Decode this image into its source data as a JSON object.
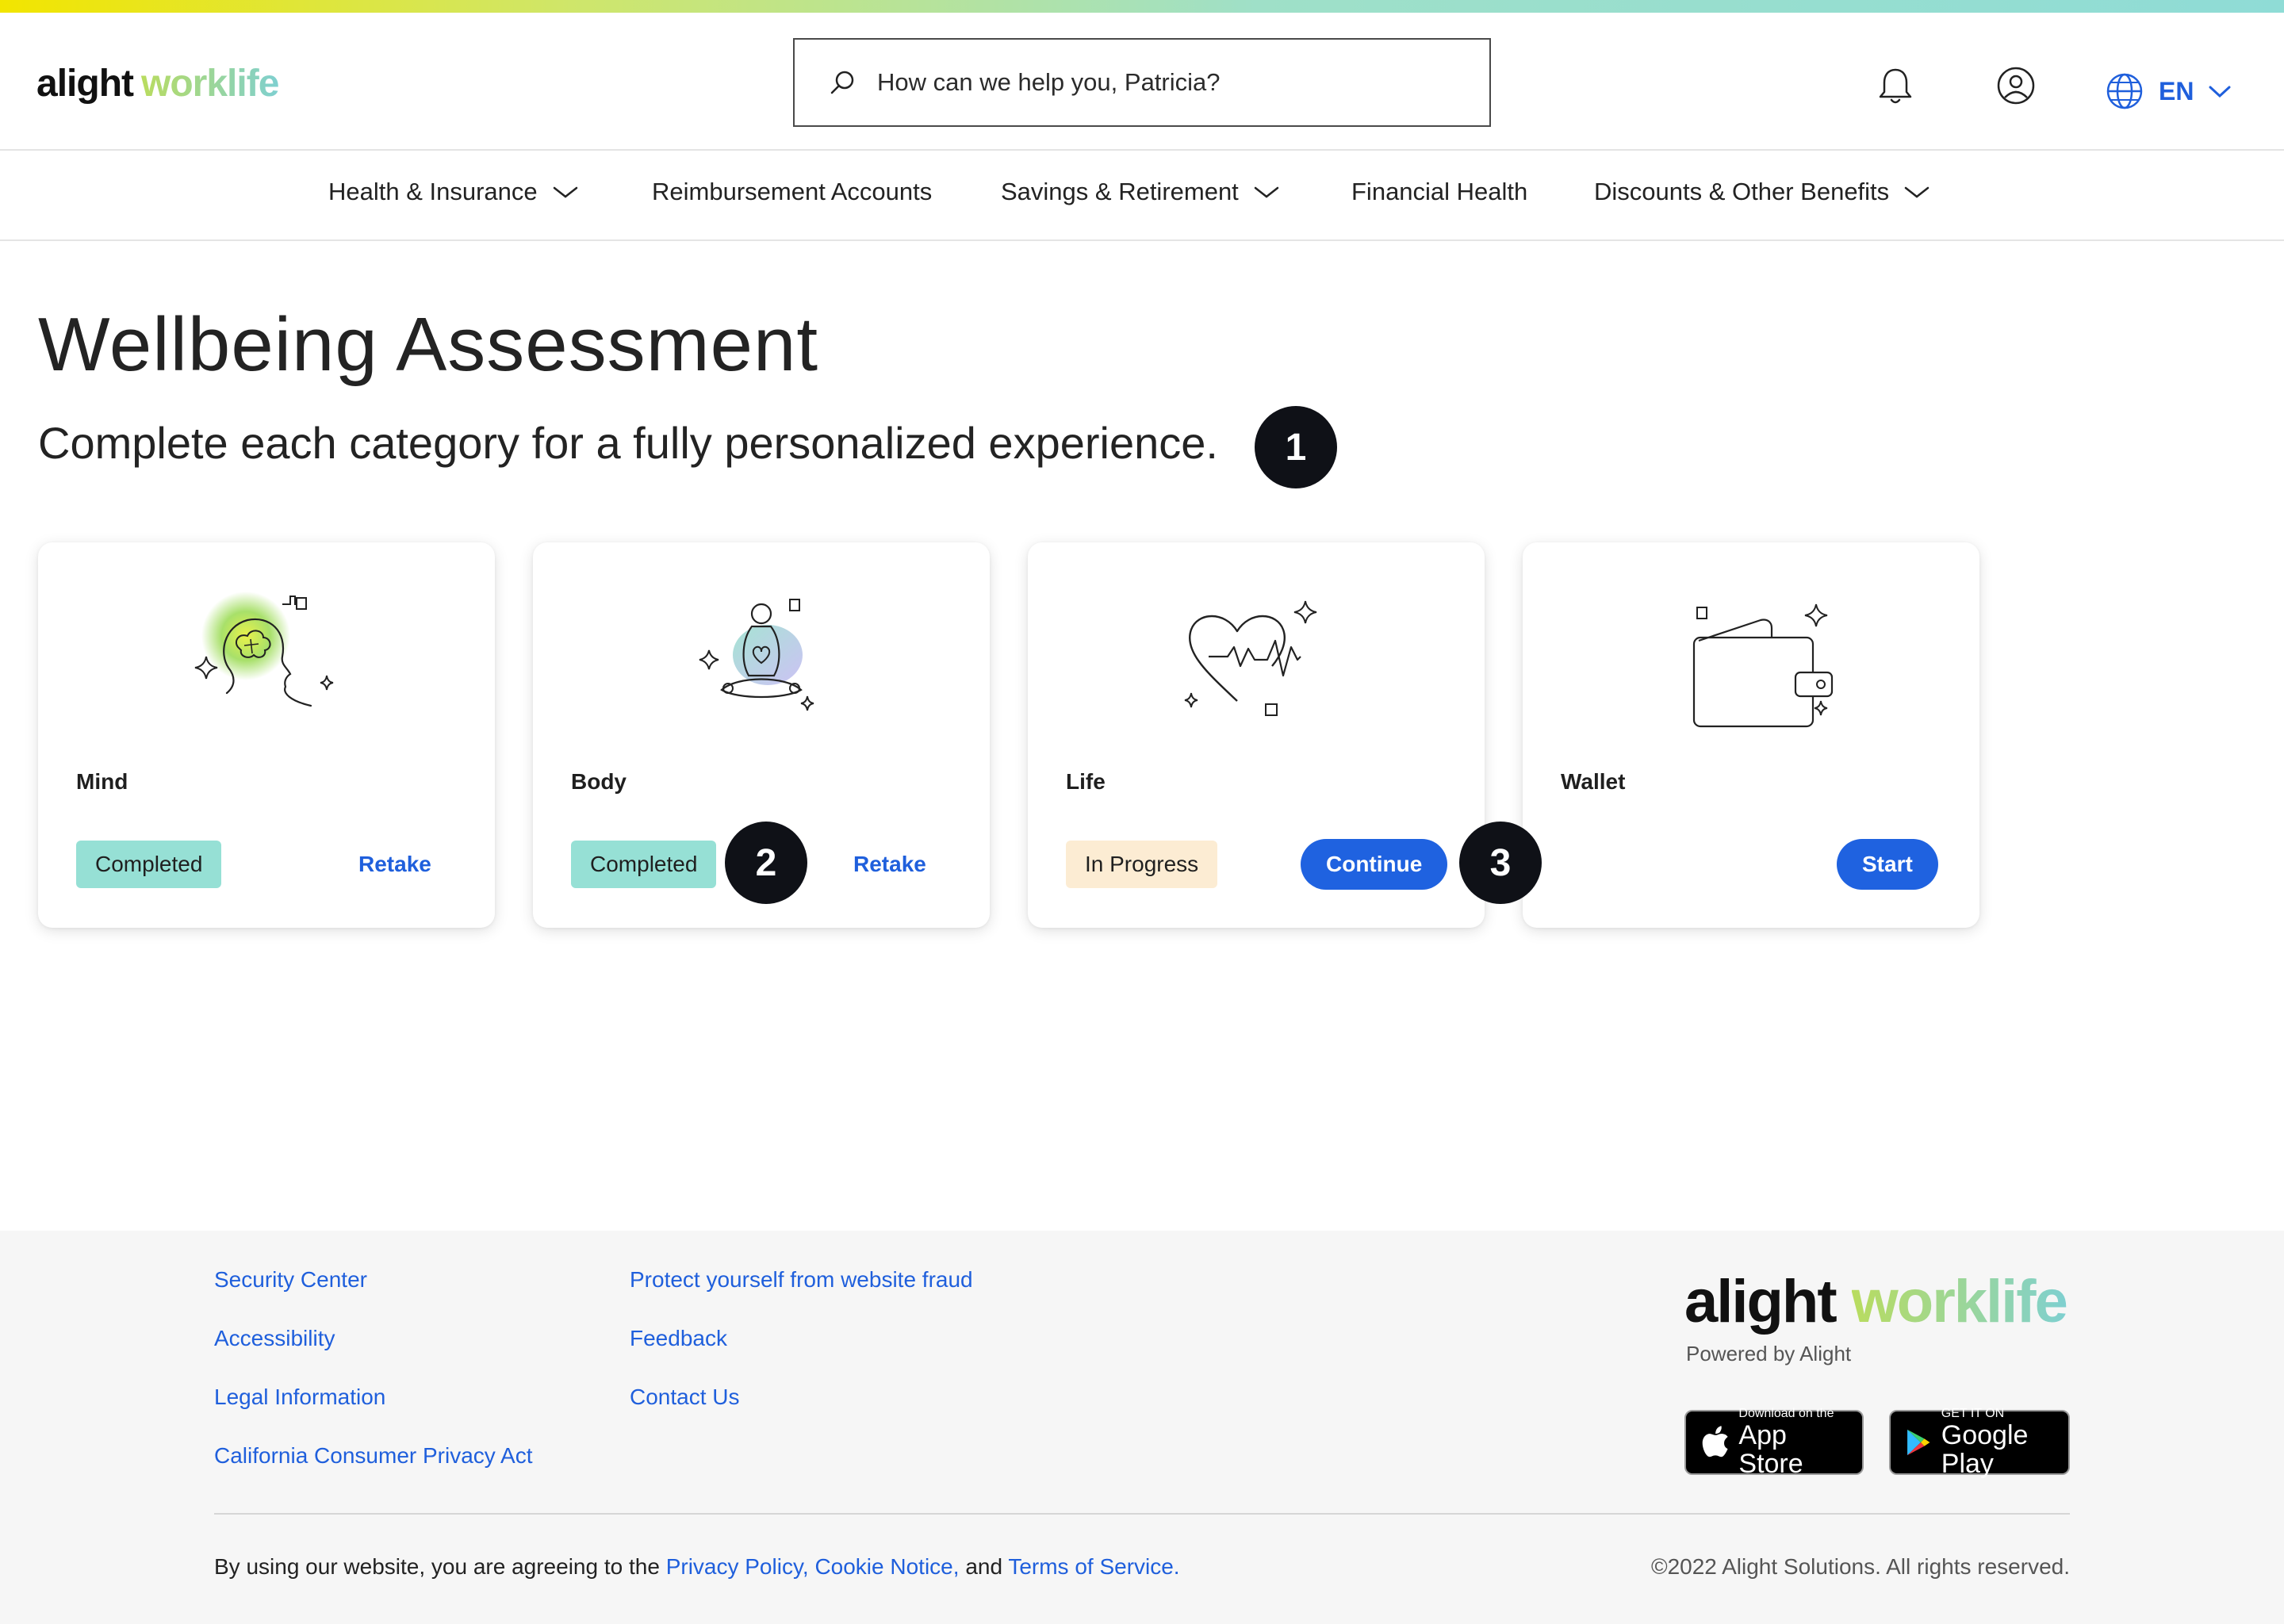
{
  "brand": {
    "logo_main": "alight",
    "logo_accent": "worklife"
  },
  "search": {
    "placeholder": "How can we help you, Patricia?"
  },
  "header": {
    "lang_code": "EN"
  },
  "nav": {
    "items": [
      {
        "label": "Health & Insurance",
        "has_dropdown": true
      },
      {
        "label": "Reimbursement Accounts",
        "has_dropdown": false
      },
      {
        "label": "Savings & Retirement",
        "has_dropdown": true
      },
      {
        "label": "Financial Health",
        "has_dropdown": false
      },
      {
        "label": "Discounts & Other Benefits",
        "has_dropdown": true
      }
    ]
  },
  "page": {
    "title": "Wellbeing Assessment",
    "subtitle": "Complete each category for a fully personalized experience."
  },
  "markers": [
    "1",
    "2",
    "3"
  ],
  "cards": [
    {
      "name": "Mind",
      "status": "Completed",
      "action": "Retake",
      "icon": "brain-head-icon"
    },
    {
      "name": "Body",
      "status": "Completed",
      "action": "Retake",
      "icon": "meditation-figure-icon"
    },
    {
      "name": "Life",
      "status": "In Progress",
      "action": "Continue",
      "icon": "heart-pulse-icon"
    },
    {
      "name": "Wallet",
      "status": "",
      "action": "Start",
      "icon": "wallet-icon"
    }
  ],
  "footer": {
    "col1": [
      "Security Center",
      "Accessibility",
      "Legal Information",
      "California Consumer Privacy Act"
    ],
    "col2": [
      "Protect yourself from website fraud",
      "Feedback",
      "Contact Us"
    ],
    "logo_main": "alight",
    "logo_accent": "worklife",
    "powered": "Powered by Alight",
    "appstore": {
      "small": "Download on the",
      "large": "App Store"
    },
    "googleplay": {
      "small": "GET IT ON",
      "large": "Google Play"
    },
    "legal_prefix": "By using our website, you are agreeing to the",
    "privacy": "Privacy Policy,",
    "cookie": "Cookie Notice,",
    "and": "and",
    "terms": "Terms of Service.",
    "copyright": "©2022 Alight Solutions. All rights reserved."
  },
  "colors": {
    "accent": "#1f62e0",
    "completed": "#96e0d5",
    "in_progress": "#fcecd3"
  }
}
